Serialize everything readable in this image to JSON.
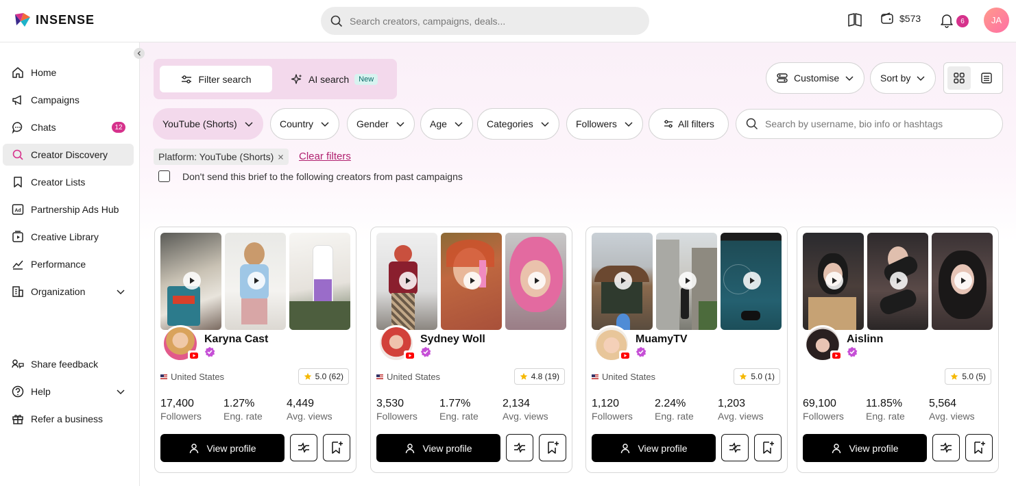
{
  "app": {
    "brand": "INSENSE"
  },
  "topbar": {
    "search_placeholder": "Search creators, campaigns, deals...",
    "balance": "$573",
    "notifications_count": "6",
    "user_initials": "JA"
  },
  "sidebar": {
    "items": [
      {
        "label": "Home",
        "icon": "home-icon"
      },
      {
        "label": "Campaigns",
        "icon": "megaphone-icon"
      },
      {
        "label": "Chats",
        "icon": "chat-icon",
        "count": "12"
      },
      {
        "label": "Creator Discovery",
        "icon": "discovery-search-icon",
        "active": true
      },
      {
        "label": "Creator Lists",
        "icon": "bookmark-icon"
      },
      {
        "label": "Partnership Ads Hub",
        "icon": "ads-icon"
      },
      {
        "label": "Creative Library",
        "icon": "library-icon"
      },
      {
        "label": "Performance",
        "icon": "chart-line-icon"
      },
      {
        "label": "Organization",
        "icon": "building-icon",
        "expandable": true
      }
    ],
    "bottom_items": [
      {
        "label": "Share feedback",
        "icon": "feedback-icon"
      },
      {
        "label": "Help",
        "icon": "help-icon",
        "expandable": true
      },
      {
        "label": "Refer a business",
        "icon": "gift-icon"
      }
    ]
  },
  "search_modes": {
    "filter_search": "Filter search",
    "ai_search": "AI search",
    "ai_badge": "New"
  },
  "toolbar": {
    "customise": "Customise",
    "sort_by": "Sort by",
    "view_modes": [
      "grid",
      "list"
    ],
    "active_view": "grid"
  },
  "filters": {
    "platform": "YouTube (Shorts)",
    "country": "Country",
    "gender": "Gender",
    "age": "Age",
    "categories": "Categories",
    "followers": "Followers",
    "all_filters": "All filters",
    "search_placeholder": "Search by username, bio info or hashtags"
  },
  "active_filters": {
    "chip_label": "Platform: YouTube (Shorts)",
    "clear_label": "Clear filters"
  },
  "exclude_brief": {
    "label": "Don't send this brief to the following creators from past campaigns",
    "checked": false
  },
  "creators": [
    {
      "name": "Karyna Cast",
      "country": "United States",
      "rating": "5.0 (62)",
      "followers": "17,400",
      "eng_rate": "1.27%",
      "avg_views": "4,449"
    },
    {
      "name": "Sydney Woll",
      "country": "United States",
      "rating": "4.8 (19)",
      "followers": "3,530",
      "eng_rate": "1.77%",
      "avg_views": "2,134"
    },
    {
      "name": "MuamyTV",
      "country": "United States",
      "rating": "5.0 (1)",
      "followers": "1,120",
      "eng_rate": "2.24%",
      "avg_views": "1,203"
    },
    {
      "name": "Aislinn",
      "country": "",
      "rating": "5.0 (5)",
      "followers": "69,100",
      "eng_rate": "11.85%",
      "avg_views": "5,564"
    }
  ],
  "card_labels": {
    "followers": "Followers",
    "eng_rate": "Eng. rate",
    "avg_views": "Avg. views",
    "view_profile": "View profile"
  },
  "colors": {
    "brand_pink": "#d6328c",
    "link_pink": "#b0206f",
    "highlight_pink": "#f3d9ec",
    "button_black": "#000000"
  }
}
